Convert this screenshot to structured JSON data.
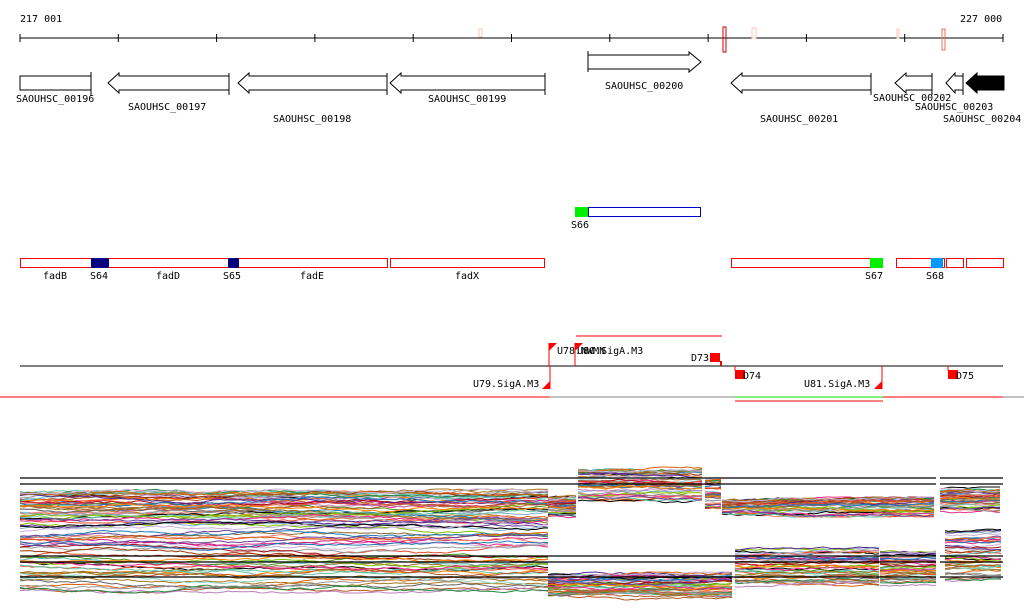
{
  "ruler": {
    "start_label": "217 001",
    "end_label": "227 000"
  },
  "genes": [
    {
      "name": "SAOUHSC_00196"
    },
    {
      "name": "SAOUHSC_00197"
    },
    {
      "name": "SAOUHSC_00198"
    },
    {
      "name": "SAOUHSC_00199"
    },
    {
      "name": "SAOUHSC_00200"
    },
    {
      "name": "SAOUHSC_00201"
    },
    {
      "name": "SAOUHSC_00202"
    },
    {
      "name": "SAOUHSC_00203"
    },
    {
      "name": "SAOUHSC_00204"
    }
  ],
  "features": {
    "s66": "S66",
    "labels": [
      "fadB",
      "S64",
      "fadD",
      "S65",
      "fadE",
      "fadX",
      "S67",
      "S68"
    ]
  },
  "tss": {
    "u78": "U78.NWMN",
    "u80": "U80.SigA.M3",
    "d73": "D73",
    "u79": "U79.SigA.M3",
    "d74": "D74",
    "u81": "U81.SigA.M3",
    "d75": "D75"
  },
  "colors": {
    "feature_border": "#ff0000",
    "s66_border": "#0000cc",
    "green": "#00ee00",
    "navy": "#000080",
    "lightblue": "#0099ff",
    "traces": [
      "#000000",
      "#e34a33",
      "#d95f0e",
      "#8c6d31",
      "#66c2a5",
      "#7fbf00",
      "#a6761d",
      "#e7298a",
      "#6a3d9a",
      "#1f78b4",
      "#b15928",
      "#ff7f00",
      "#999999",
      "#cab2d6",
      "#80b1d3",
      "#bc80bd",
      "#8dd3c7",
      "#5ab4ac",
      "#c51b7d",
      "#4d9221",
      "#fb8072",
      "#666666",
      "#993404",
      "#238b45",
      "#a50f15",
      "#54278f"
    ]
  }
}
